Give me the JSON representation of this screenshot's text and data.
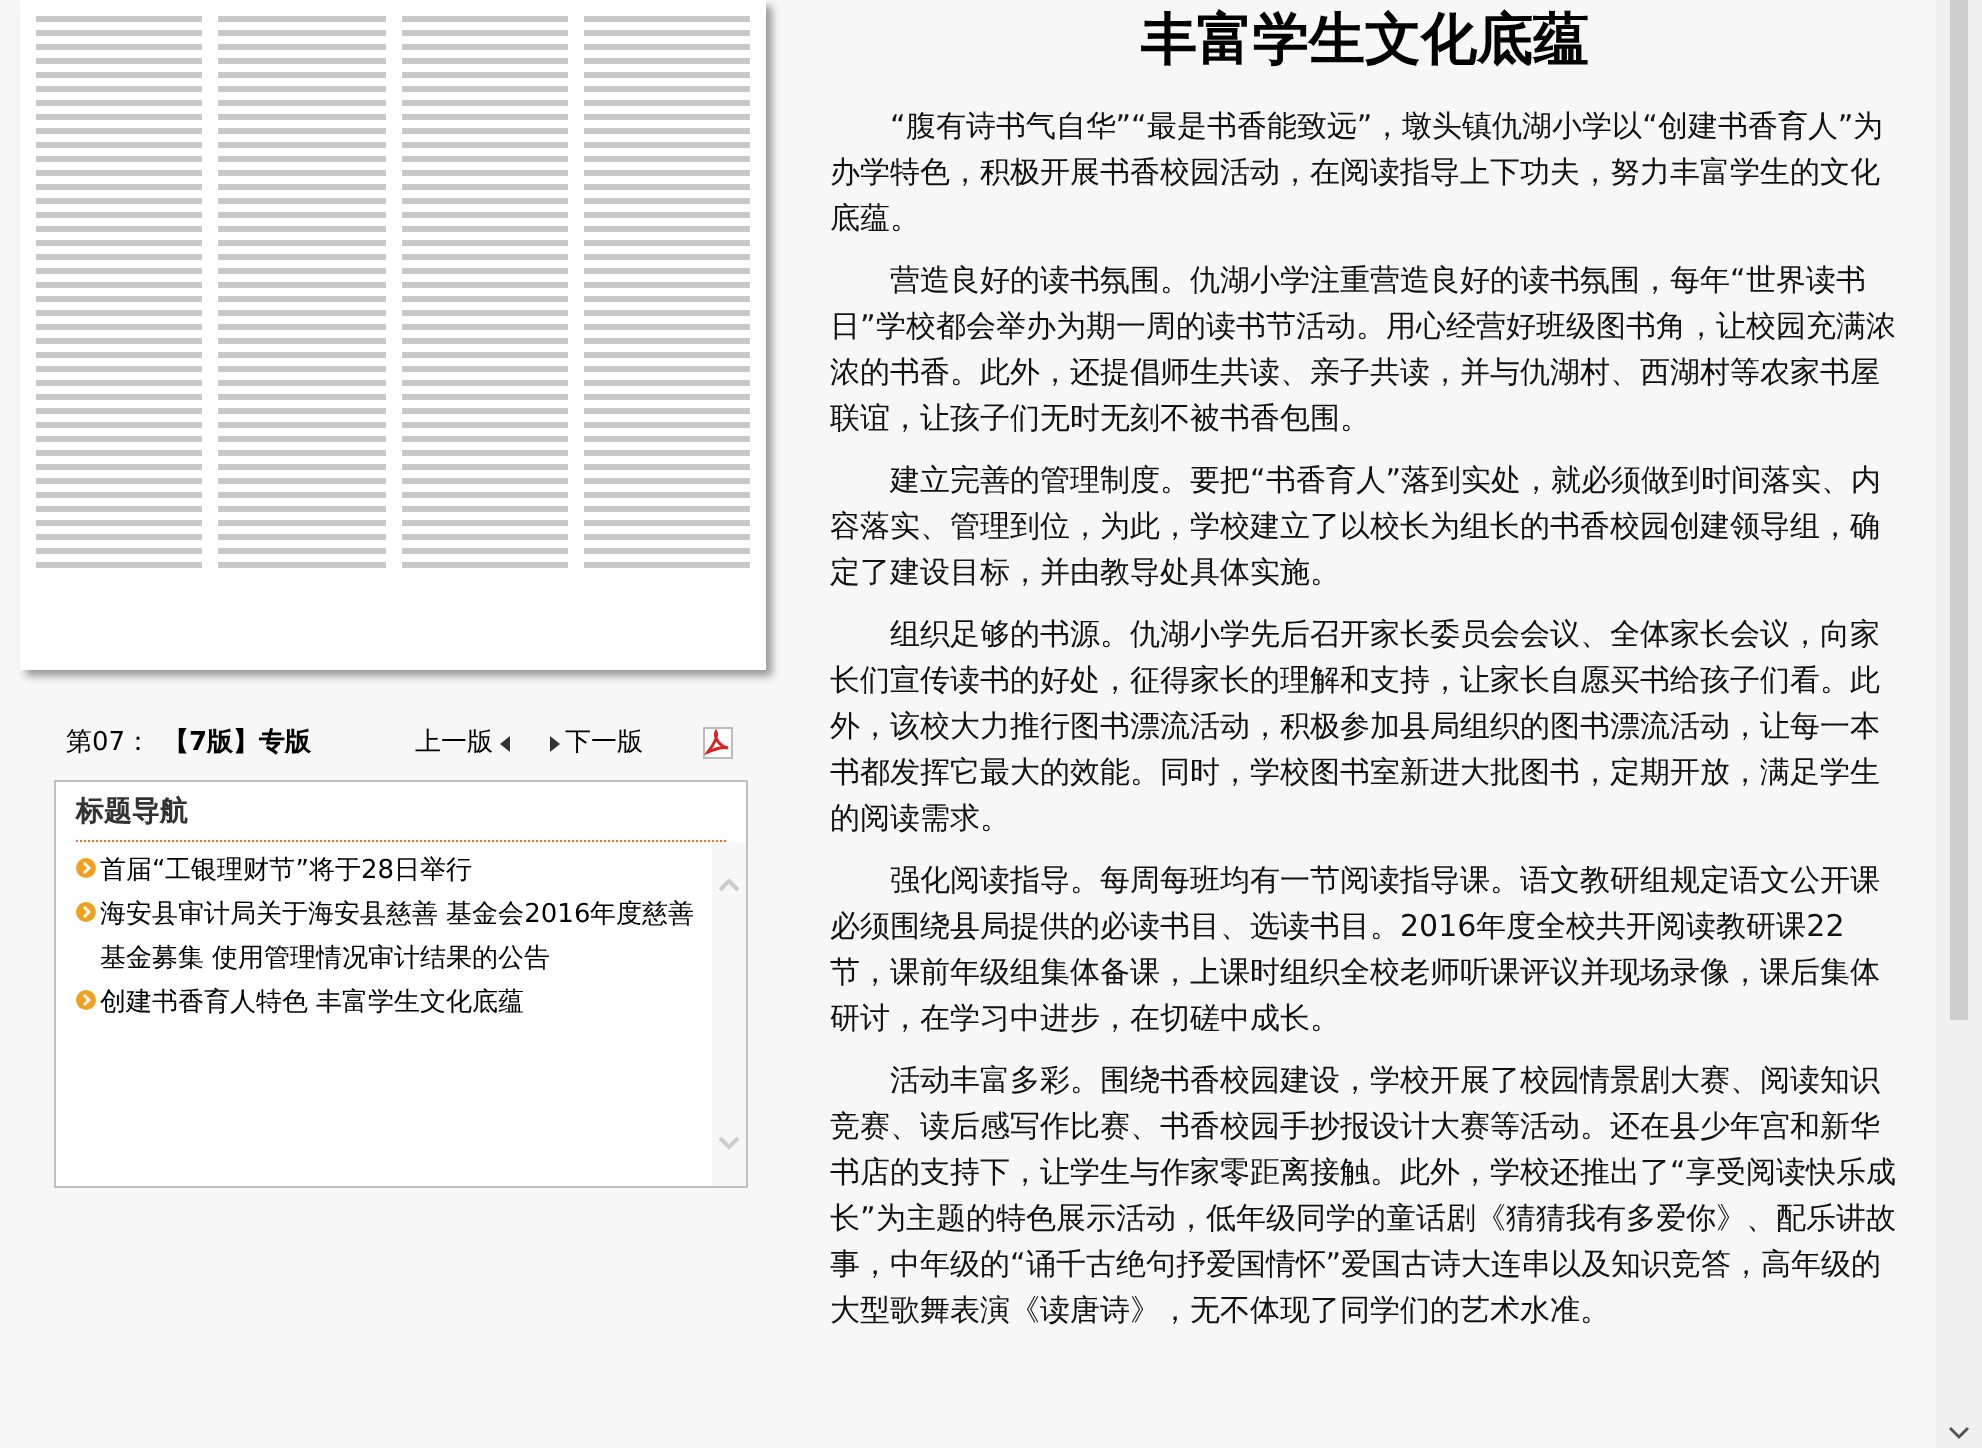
{
  "edition_bar": {
    "page_label": "第07：",
    "edition": "【7版】专版",
    "prev_link": "上一版",
    "next_link": "下一版"
  },
  "title_nav": {
    "heading": "标题导航",
    "items": [
      {
        "label": "首届“工银理财节”将于28日举行"
      },
      {
        "label": "海安县审计局关于海安县慈善 基金会2016年度慈善基金募集 使用管理情况审计结果的公告"
      },
      {
        "label": "创建书香育人特色 丰富学生文化底蕴"
      }
    ]
  },
  "article": {
    "title": "丰富学生文化底蕴",
    "paragraphs": [
      "“腹有诗书气自华”“最是书香能致远”，墩头镇仇湖小学以“创建书香育人”为办学特色，积极开展书香校园活动，在阅读指导上下功夫，努力丰富学生的文化底蕴。",
      "营造良好的读书氛围。仇湖小学注重营造良好的读书氛围，每年“世界读书日”学校都会举办为期一周的读书节活动。用心经营好班级图书角，让校园充满浓浓的书香。此外，还提倡师生共读、亲子共读，并与仇湖村、西湖村等农家书屋联谊，让孩子们无时无刻不被书香包围。",
      "建立完善的管理制度。要把“书香育人”落到实处，就必须做到时间落实、内容落实、管理到位，为此，学校建立了以校长为组长的书香校园创建领导组，确定了建设目标，并由教导处具体实施。",
      "组织足够的书源。仇湖小学先后召开家长委员会会议、全体家长会议，向家长们宣传读书的好处，征得家长的理解和支持，让家长自愿买书给孩子们看。此外，该校大力推行图书漂流活动，积极参加县局组织的图书漂流活动，让每一本书都发挥它最大的效能。同时，学校图书室新进大批图书，定期开放，满足学生的阅读需求。",
      "强化阅读指导。每周每班均有一节阅读指导课。语文教研组规定语文公开课必须围绕县局提供的必读书目、选读书目。2016年度全校共开阅读教研课22节，课前年级组集体备课，上课时组织全校老师听课评议并现场录像，课后集体研讨，在学习中进步，在切磋中成长。",
      "活动丰富多彩。围绕书香校园建设，学校开展了校园情景剧大赛、阅读知识竞赛、读后感写作比赛、书香校园手抄报设计大赛等活动。还在县少年宫和新华书店的支持下，让学生与作家零距离接触。此外，学校还推出了“享受阅读快乐成长”为主题的特色展示活动，低年级同学的童话剧《猜猜我有多爱你》、配乐讲故事，中年级的“诵千古绝句抒爱国情怀”爱国古诗大连串以及知识竞答，高年级的大型歌舞表演《读唐诗》，无不体现了同学们的艺术水准。"
    ]
  }
}
